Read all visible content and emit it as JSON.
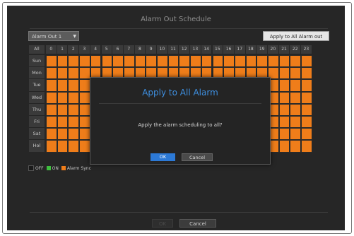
{
  "window": {
    "title": "Alarm Out Schedule"
  },
  "toolbar": {
    "dropdown_value": "Alarm Out 1",
    "apply_all_label": "Apply to All Alarm out"
  },
  "grid": {
    "corner_label": "All",
    "hours": [
      "0",
      "1",
      "2",
      "3",
      "4",
      "5",
      "6",
      "7",
      "8",
      "9",
      "10",
      "11",
      "12",
      "13",
      "14",
      "15",
      "16",
      "17",
      "18",
      "19",
      "20",
      "21",
      "22",
      "23"
    ],
    "days": [
      "Sun",
      "Mon",
      "Tue",
      "Wed",
      "Thu",
      "Fri",
      "Sat",
      "Hol"
    ],
    "cell_state": "Alarm Sync"
  },
  "legend": {
    "items": [
      {
        "label": "OFF",
        "color": "#1a1a1a"
      },
      {
        "label": "ON",
        "color": "#3fbf3f"
      },
      {
        "label": "Alarm Sync",
        "color": "#ef7d1a"
      }
    ]
  },
  "footer": {
    "ok_label": "OK",
    "cancel_label": "Cancel"
  },
  "dialog": {
    "title": "Apply to All Alarm",
    "message": "Apply the alarm scheduling to all?",
    "ok_label": "OK",
    "cancel_label": "Cancel"
  }
}
